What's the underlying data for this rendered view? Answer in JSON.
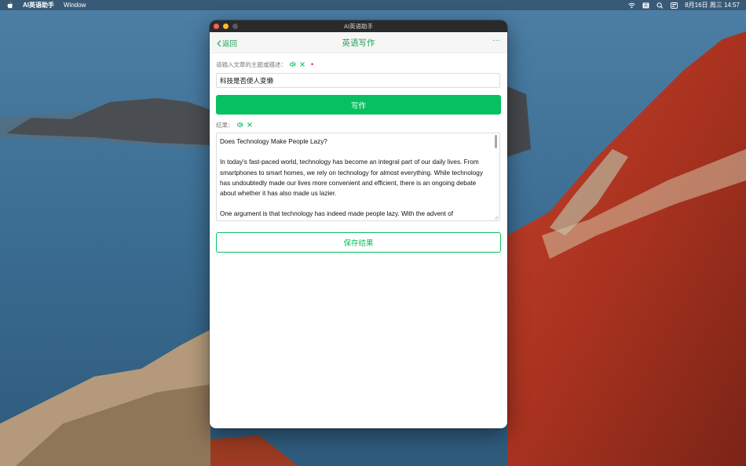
{
  "menubar": {
    "app_name": "AI英语助手",
    "menu_window": "Window",
    "date_time": "8月16日 周三  14:57"
  },
  "window": {
    "title": "AI英语助手"
  },
  "navbar": {
    "back_label": "返回",
    "title": "英语写作",
    "more_label": "···"
  },
  "form": {
    "topic_label": "请输入文章的主题或描述：",
    "required_mark": "•",
    "topic_value": "科技是否使人变懒",
    "write_button": "写作",
    "result_label": "结果：",
    "result_text": "Does Technology Make People Lazy?\n\nIn today's fast-paced world, technology has become an integral part of our daily lives. From smartphones to smart homes, we rely on technology for almost everything. While technology has undoubtedly made our lives more convenient and efficient, there is an ongoing debate about whether it has also made us lazier.\n\nOne argument is that technology has indeed made people lazy. With the advent of smartphones",
    "save_button": "保存结果"
  },
  "colors": {
    "accent": "#07c160",
    "accent_text": "#1fa35a",
    "required": "#e02020"
  },
  "icons": [
    "apple-icon",
    "wifi-icon",
    "keyboard-icon",
    "search-icon",
    "control-center-icon",
    "back-chevron-icon",
    "more-icon",
    "speaker-icon",
    "clear-icon"
  ]
}
